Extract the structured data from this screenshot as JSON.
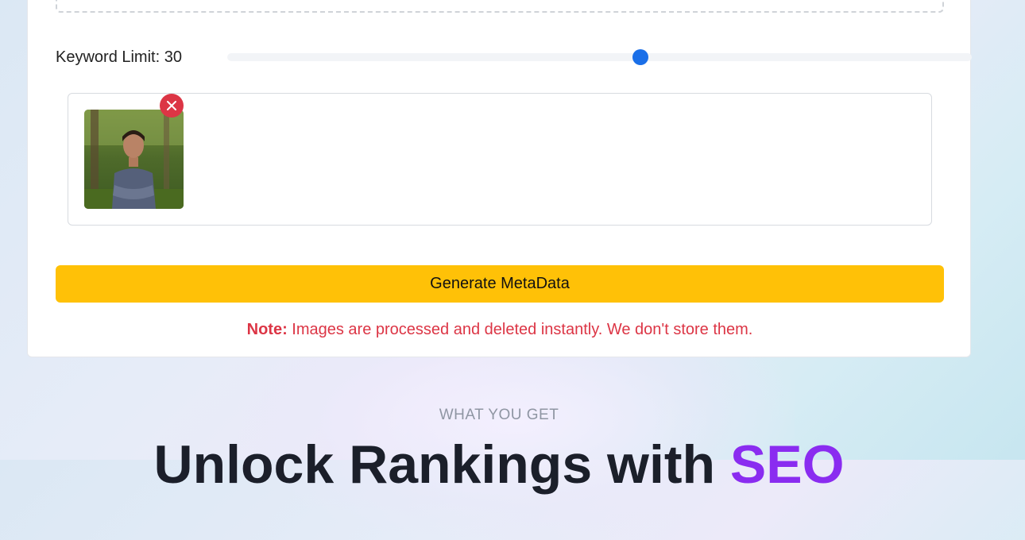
{
  "keyword_limit": {
    "label": "Keyword Limit:",
    "value": "30",
    "slider_fraction": 0.555,
    "accent_color": "#1a6fe8"
  },
  "preview": {
    "image_alt": "Uploaded photo of a man in a checkered shirt",
    "remove_icon": "close-icon"
  },
  "generate_button": {
    "label": "Generate MetaData",
    "color": "#ffc107"
  },
  "note": {
    "prefix": "Note:",
    "text": " Images are processed and deleted instantly. We don't store them.",
    "color": "#dc3545"
  },
  "section": {
    "eyebrow": "WHAT YOU GET",
    "title_main": "Unlock Rankings with ",
    "title_accent": "SEO",
    "accent_color": "#8a2cf0"
  }
}
